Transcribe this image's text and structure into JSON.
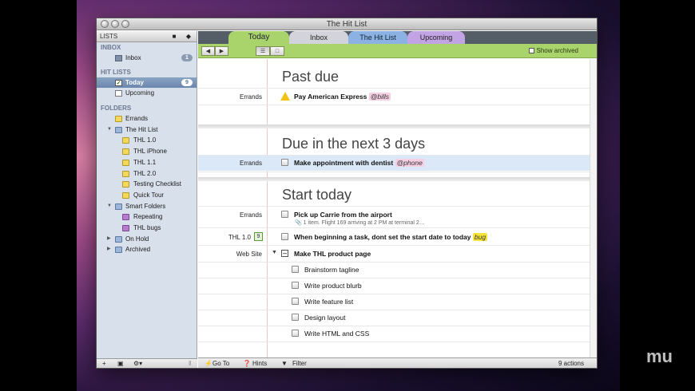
{
  "window": {
    "title": "The Hit List"
  },
  "sidebar": {
    "header": "LISTS",
    "sections": {
      "inbox": "INBOX",
      "hitlists": "HIT LISTS",
      "folders": "FOLDERS"
    },
    "inbox": {
      "label": "Inbox",
      "count": "1"
    },
    "today": {
      "label": "Today",
      "count": "9"
    },
    "upcoming": {
      "label": "Upcoming"
    },
    "folders": {
      "errands": "Errands",
      "hitlist": "The Hit List",
      "thl10": "THL 1.0",
      "thliphone": "THL iPhone",
      "thl11": "THL 1.1",
      "thl20": "THL 2.0",
      "testing": "Testing Checklist",
      "quicktour": "Quick Tour",
      "smart": "Smart Folders",
      "repeating": "Repeating",
      "thlbugs": "THL bugs",
      "onhold": "On Hold",
      "archived": "Archived"
    }
  },
  "tabs": {
    "today": "Today",
    "inbox": "Inbox",
    "hitlist": "The Hit List",
    "upcoming": "Upcoming"
  },
  "toolbar": {
    "show_archived": "Show archived"
  },
  "sections": {
    "pastdue": "Past due",
    "next3": "Due in the next 3 days",
    "starttoday": "Start today"
  },
  "tasks": {
    "t1": {
      "context": "Errands",
      "title": "Pay American Express",
      "tag": "@bills"
    },
    "t2": {
      "context": "Errands",
      "title": "Make appointment with dentist",
      "tag": "@phone"
    },
    "t3": {
      "context": "Errands",
      "title": "Pick up Carrie from the airport",
      "note": "1 item.  Flight 169 arriving at 2 PM at terminal 2…"
    },
    "t4": {
      "context": "THL 1.0",
      "badge": "9",
      "title": "When beginning a task, dont set the start date to today",
      "tag": "bug"
    },
    "t5": {
      "context": "Web Site",
      "title": "Make THL product page"
    },
    "sub": [
      "Brainstorm tagline",
      "Write product blurb",
      "Write feature list",
      "Design layout",
      "Write HTML and CSS"
    ]
  },
  "footer": {
    "goto": "Go To",
    "hints": "Hints",
    "filter": "Filter",
    "count": "9 actions"
  },
  "watermark": "mu"
}
